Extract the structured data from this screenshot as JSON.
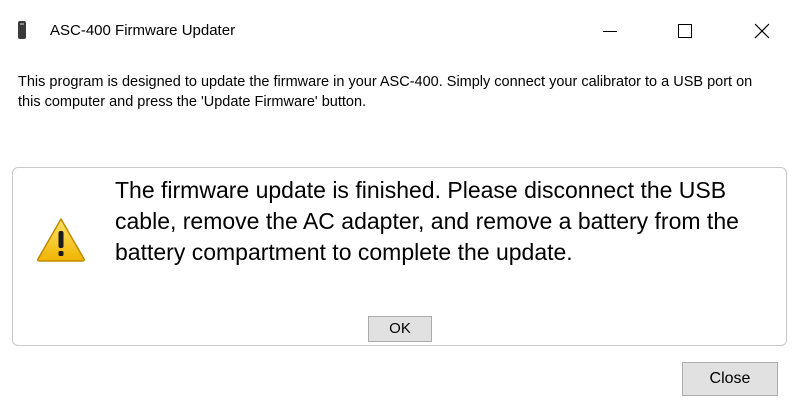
{
  "window": {
    "title": "ASC-400 Firmware Updater",
    "icon": "usb-drive-icon",
    "controls": [
      "minimize-icon",
      "maximize-icon",
      "close-icon"
    ]
  },
  "intro_text": "This program is designed to update the firmware in your ASC-400.  Simply connect your calibrator to a USB port on this computer and press the 'Update Firmware' button.",
  "message_box": {
    "icon": "warning-icon",
    "message": "The firmware update is finished.  Please disconnect the USB cable, remove the AC adapter, and remove a battery from the battery compartment to complete the update.",
    "ok_label": "OK"
  },
  "footer": {
    "close_label": "Close"
  },
  "colors": {
    "warning_fill": "#f5c20f",
    "warning_border": "#c08a00",
    "button_bg": "#e1e1e1",
    "button_border": "#adadad"
  }
}
